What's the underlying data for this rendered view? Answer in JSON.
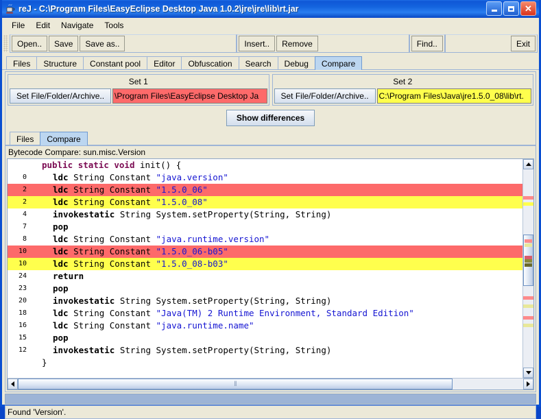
{
  "window": {
    "title": "reJ - C:\\Program Files\\EasyEclipse Desktop Java 1.0.2\\jre\\jre\\lib\\rt.jar",
    "icon": "java-cup-icon",
    "minimize_label": "_",
    "maximize_label": "□",
    "close_label": "✕"
  },
  "menubar": {
    "items": [
      {
        "label": "File"
      },
      {
        "label": "Edit"
      },
      {
        "label": "Navigate"
      },
      {
        "label": "Tools"
      }
    ]
  },
  "toolbar": {
    "group1": [
      {
        "label": "Open..",
        "name": "open-button"
      },
      {
        "label": "Save",
        "name": "save-button"
      },
      {
        "label": "Save as..",
        "name": "save-as-button"
      }
    ],
    "group2": [
      {
        "label": "Insert..",
        "name": "insert-button"
      },
      {
        "label": "Remove",
        "name": "remove-button"
      }
    ],
    "group3": [
      {
        "label": "Find..",
        "name": "find-button"
      }
    ],
    "group4": [
      {
        "label": "Exit",
        "name": "exit-button"
      }
    ]
  },
  "main_tabs": {
    "selected": "Compare",
    "items": [
      {
        "label": "Files"
      },
      {
        "label": "Structure"
      },
      {
        "label": "Constant pool"
      },
      {
        "label": "Editor"
      },
      {
        "label": "Obfuscation"
      },
      {
        "label": "Search"
      },
      {
        "label": "Debug"
      },
      {
        "label": "Compare"
      }
    ]
  },
  "compare_panel": {
    "set1": {
      "title": "Set 1",
      "button_label": "Set File/Folder/Archive..",
      "path_value": "\\Program Files\\EasyEclipse Desktop Ja",
      "path_color": "#fd6a6a"
    },
    "set2": {
      "title": "Set 2",
      "button_label": "Set File/Folder/Archive..",
      "path_value": "C:\\Program Files\\Java\\jre1.5.0_08\\lib\\rt.",
      "path_color": "#ffff4d"
    },
    "show_differences_label": "Show differences"
  },
  "inner_tabs": {
    "selected": "Compare",
    "items": [
      {
        "label": "Files"
      },
      {
        "label": "Compare"
      }
    ]
  },
  "caption": "Bytecode Compare: sun.misc.Version",
  "code": {
    "lines": [
      {
        "num": "",
        "indent": 1,
        "highlight": "none",
        "tokens": [
          {
            "t": "public",
            "c": "kw"
          },
          {
            "t": " ",
            "c": "pl"
          },
          {
            "t": "static",
            "c": "kw"
          },
          {
            "t": " ",
            "c": "pl"
          },
          {
            "t": "void",
            "c": "kw"
          },
          {
            "t": " init() {",
            "c": "pl"
          }
        ]
      },
      {
        "num": "0",
        "indent": 2,
        "highlight": "none",
        "tokens": [
          {
            "t": "ldc",
            "c": "op"
          },
          {
            "t": " String Constant ",
            "c": "pl"
          },
          {
            "t": "\"java.version\"",
            "c": "str"
          }
        ]
      },
      {
        "num": "2",
        "indent": 2,
        "highlight": "red",
        "tokens": [
          {
            "t": "ldc",
            "c": "op"
          },
          {
            "t": " String Constant ",
            "c": "pl"
          },
          {
            "t": "\"1.5.0_06\"",
            "c": "str"
          }
        ]
      },
      {
        "num": "2",
        "indent": 2,
        "highlight": "yellow",
        "tokens": [
          {
            "t": "ldc",
            "c": "op"
          },
          {
            "t": " String Constant ",
            "c": "pl"
          },
          {
            "t": "\"1.5.0_08\"",
            "c": "str"
          }
        ]
      },
      {
        "num": "4",
        "indent": 2,
        "highlight": "none",
        "tokens": [
          {
            "t": "invokestatic",
            "c": "op"
          },
          {
            "t": " String System.setProperty(String, String)",
            "c": "pl"
          }
        ]
      },
      {
        "num": "7",
        "indent": 2,
        "highlight": "none",
        "tokens": [
          {
            "t": "pop",
            "c": "op"
          }
        ]
      },
      {
        "num": "8",
        "indent": 2,
        "highlight": "none",
        "tokens": [
          {
            "t": "ldc",
            "c": "op"
          },
          {
            "t": " String Constant ",
            "c": "pl"
          },
          {
            "t": "\"java.runtime.version\"",
            "c": "str"
          }
        ]
      },
      {
        "num": "10",
        "indent": 2,
        "highlight": "red",
        "tokens": [
          {
            "t": "ldc",
            "c": "op"
          },
          {
            "t": " String Constant ",
            "c": "pl"
          },
          {
            "t": "\"1.5.0_06-b05\"",
            "c": "str"
          }
        ]
      },
      {
        "num": "10",
        "indent": 2,
        "highlight": "yellow",
        "tokens": [
          {
            "t": "ldc",
            "c": "op"
          },
          {
            "t": " String Constant ",
            "c": "pl"
          },
          {
            "t": "\"1.5.0_08-b03\"",
            "c": "str"
          }
        ]
      },
      {
        "num": "24",
        "indent": 2,
        "highlight": "none",
        "tokens": [
          {
            "t": "return",
            "c": "op"
          }
        ]
      },
      {
        "num": "23",
        "indent": 2,
        "highlight": "none",
        "tokens": [
          {
            "t": "pop",
            "c": "op"
          }
        ]
      },
      {
        "num": "20",
        "indent": 2,
        "highlight": "none",
        "tokens": [
          {
            "t": "invokestatic",
            "c": "op"
          },
          {
            "t": " String System.setProperty(String, String)",
            "c": "pl"
          }
        ]
      },
      {
        "num": "18",
        "indent": 2,
        "highlight": "none",
        "tokens": [
          {
            "t": "ldc",
            "c": "op"
          },
          {
            "t": " String Constant ",
            "c": "pl"
          },
          {
            "t": "\"Java(TM) 2 Runtime Environment, Standard Edition\"",
            "c": "str"
          }
        ]
      },
      {
        "num": "16",
        "indent": 2,
        "highlight": "none",
        "tokens": [
          {
            "t": "ldc",
            "c": "op"
          },
          {
            "t": " String Constant ",
            "c": "pl"
          },
          {
            "t": "\"java.runtime.name\"",
            "c": "str"
          }
        ]
      },
      {
        "num": "15",
        "indent": 2,
        "highlight": "none",
        "tokens": [
          {
            "t": "pop",
            "c": "op"
          }
        ]
      },
      {
        "num": "12",
        "indent": 2,
        "highlight": "none",
        "tokens": [
          {
            "t": "invokestatic",
            "c": "op"
          },
          {
            "t": " String System.setProperty(String, String)",
            "c": "pl"
          }
        ]
      },
      {
        "num": "",
        "indent": 1,
        "highlight": "none",
        "tokens": [
          {
            "t": "}",
            "c": "pl"
          }
        ]
      }
    ]
  },
  "vscrollbar": {
    "marks": [
      {
        "top_pct": 13.5,
        "color": "#fd8a8a"
      },
      {
        "top_pct": 16.5,
        "color": "#ffff4d"
      }
    ],
    "thumb": {
      "top_pct": 33,
      "height_pct": 26
    },
    "thumb_marks": [
      {
        "top_pct": 8,
        "color": "#fd8a8a"
      },
      {
        "top_pct": 16,
        "color": "#e8e89a"
      },
      {
        "top_pct": 40,
        "color": "#d85a6a"
      },
      {
        "top_pct": 48,
        "color": "#8a8a3a"
      },
      {
        "top_pct": 55,
        "color": "#6a6a2a"
      }
    ],
    "lower_marks": [
      {
        "top_pct": 64,
        "color": "#fd8a8a"
      },
      {
        "top_pct": 68,
        "color": "#e8e89a"
      },
      {
        "top_pct": 74,
        "color": "#fd8a8a"
      },
      {
        "top_pct": 78,
        "color": "#e8e89a"
      }
    ]
  },
  "hscrollbar": {
    "thumb_width_pct": 86,
    "grip": "‖"
  },
  "statusbar": {
    "text": "Found 'Version'."
  }
}
